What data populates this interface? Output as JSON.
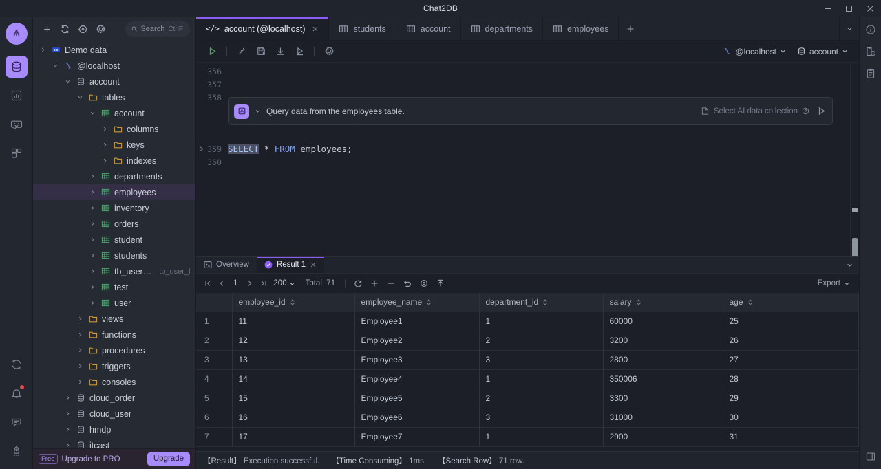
{
  "window": {
    "title": "Chat2DB",
    "controls": {
      "minimize": "minimize-icon",
      "maximize": "maximize-icon",
      "close": "close-icon"
    }
  },
  "rail": {
    "items": [
      {
        "icon": "chat2db-logo-icon",
        "name": "app-logo",
        "active": false
      },
      {
        "icon": "database-icon",
        "name": "rail-item-database",
        "active": true
      },
      {
        "icon": "chart-bar-icon",
        "name": "rail-item-dashboard",
        "active": false
      },
      {
        "icon": "chat-smile-icon",
        "name": "rail-item-ai-chat",
        "active": false
      },
      {
        "icon": "apps-grid-icon",
        "name": "rail-item-extensions",
        "active": false
      }
    ],
    "bottom_items": [
      {
        "icon": "refresh-icon",
        "name": "rail-item-refresh",
        "badge": false
      },
      {
        "icon": "bell-icon",
        "name": "rail-item-notifications",
        "badge": true
      },
      {
        "icon": "feedback-icon",
        "name": "rail-item-feedback",
        "badge": false
      },
      {
        "icon": "rocket-icon",
        "name": "rail-item-upgrade",
        "badge": false
      }
    ]
  },
  "sidebar": {
    "toolbar": [
      {
        "icon": "plus-icon",
        "name": "add-connection-button"
      },
      {
        "icon": "refresh-icon",
        "name": "refresh-tree-button"
      },
      {
        "icon": "target-icon",
        "name": "locate-button"
      },
      {
        "icon": "gear-icon",
        "name": "settings-button"
      }
    ],
    "search": {
      "placeholder": "Search",
      "shortcut": "CtrlF"
    },
    "tree": [
      {
        "label": "Demo data",
        "depth": 0,
        "icon": "demo-data-icon",
        "caret": "closed",
        "selected": false
      },
      {
        "label": "@localhost",
        "depth": 1,
        "icon": "connection-icon",
        "caret": "open",
        "selected": false
      },
      {
        "label": "account",
        "depth": 2,
        "icon": "database-icon",
        "caret": "open",
        "selected": false
      },
      {
        "label": "tables",
        "depth": 3,
        "icon": "folder-icon",
        "caret": "open",
        "selected": false
      },
      {
        "label": "account",
        "depth": 4,
        "icon": "table-icon",
        "caret": "open",
        "selected": false
      },
      {
        "label": "columns",
        "depth": 5,
        "icon": "folder-icon",
        "caret": "closed",
        "selected": false
      },
      {
        "label": "keys",
        "depth": 5,
        "icon": "folder-icon",
        "caret": "closed",
        "selected": false
      },
      {
        "label": "indexes",
        "depth": 5,
        "icon": "folder-icon",
        "caret": "closed",
        "selected": false
      },
      {
        "label": "departments",
        "depth": 4,
        "icon": "table-icon",
        "caret": "closed",
        "selected": false
      },
      {
        "label": "employees",
        "depth": 4,
        "icon": "table-icon",
        "caret": "closed",
        "selected": true
      },
      {
        "label": "inventory",
        "depth": 4,
        "icon": "table-icon",
        "caret": "closed",
        "selected": false
      },
      {
        "label": "orders",
        "depth": 4,
        "icon": "table-icon",
        "caret": "closed",
        "selected": false
      },
      {
        "label": "student",
        "depth": 4,
        "icon": "table-icon",
        "caret": "closed",
        "selected": false
      },
      {
        "label": "students",
        "depth": 4,
        "icon": "table-icon",
        "caret": "closed",
        "selected": false
      },
      {
        "label": "tb_user_local",
        "sublabel": "tb_user_loca",
        "depth": 4,
        "icon": "table-icon",
        "caret": "closed",
        "selected": false
      },
      {
        "label": "test",
        "depth": 4,
        "icon": "table-icon",
        "caret": "closed",
        "selected": false
      },
      {
        "label": "user",
        "depth": 4,
        "icon": "table-icon",
        "caret": "closed",
        "selected": false
      },
      {
        "label": "views",
        "depth": 3,
        "icon": "folder-icon",
        "caret": "closed",
        "selected": false
      },
      {
        "label": "functions",
        "depth": 3,
        "icon": "folder-icon",
        "caret": "closed",
        "selected": false
      },
      {
        "label": "procedures",
        "depth": 3,
        "icon": "folder-icon",
        "caret": "closed",
        "selected": false
      },
      {
        "label": "triggers",
        "depth": 3,
        "icon": "folder-icon",
        "caret": "closed",
        "selected": false
      },
      {
        "label": "consoles",
        "depth": 3,
        "icon": "folder-icon",
        "caret": "closed",
        "selected": false
      },
      {
        "label": "cloud_order",
        "depth": 2,
        "icon": "database-icon",
        "caret": "closed",
        "selected": false
      },
      {
        "label": "cloud_user",
        "depth": 2,
        "icon": "database-icon",
        "caret": "closed",
        "selected": false
      },
      {
        "label": "hmdp",
        "depth": 2,
        "icon": "database-icon",
        "caret": "closed",
        "selected": false
      },
      {
        "label": "itcast",
        "depth": 2,
        "icon": "database-icon",
        "caret": "closed",
        "selected": false
      }
    ],
    "upgrade": {
      "badge": "Free",
      "text": "Upgrade to PRO",
      "button": "Upgrade"
    }
  },
  "tabs": [
    {
      "label": "account (@localhost)",
      "icon": "code-icon",
      "active": true,
      "closable": true
    },
    {
      "label": "students",
      "icon": "table-icon",
      "active": false,
      "closable": false
    },
    {
      "label": "account",
      "icon": "table-icon",
      "active": false,
      "closable": false
    },
    {
      "label": "departments",
      "icon": "table-icon",
      "active": false,
      "closable": false
    },
    {
      "label": "employees",
      "icon": "table-icon",
      "active": false,
      "closable": false
    }
  ],
  "editor_toolbar": {
    "buttons": [
      {
        "icon": "play-icon",
        "name": "execute-button"
      },
      {
        "icon": "magic-wand-icon",
        "name": "format-sql-button"
      },
      {
        "icon": "save-icon",
        "name": "save-button"
      },
      {
        "icon": "download-icon",
        "name": "download-button"
      },
      {
        "icon": "play-outline-icon",
        "name": "execute-to-file-button"
      },
      {
        "icon": "gear-icon",
        "name": "editor-settings-button"
      }
    ],
    "connection": "@localhost",
    "database": "account"
  },
  "editor": {
    "lines": [
      {
        "number": "356",
        "text": "",
        "current": false
      },
      {
        "number": "357",
        "text": "",
        "current": false
      },
      {
        "number": "358",
        "text": "",
        "current": false
      },
      {
        "number": "359",
        "text": "SELECT * FROM employees;",
        "current": true
      },
      {
        "number": "360",
        "text": "",
        "current": false
      }
    ],
    "sql_tokens": {
      "keyword1": "SELECT",
      "star": "*",
      "keyword2": "FROM",
      "table": "employees;"
    },
    "ai_bar": {
      "prompt": "Query data from the employees table.",
      "collection_label": "Select AI data collection",
      "send_icon": "send-icon"
    }
  },
  "result_panel": {
    "tabs": [
      {
        "label": "Overview",
        "icon": "terminal-icon",
        "active": false,
        "closable": false
      },
      {
        "label": "Result 1",
        "icon": "success-check-icon",
        "active": true,
        "closable": true
      }
    ],
    "pagination": {
      "page": "1",
      "page_size": "200",
      "total_label": "Total:",
      "total": "71"
    },
    "toolbar_icons": [
      {
        "icon": "refresh-icon",
        "name": "refresh-result-button"
      },
      {
        "icon": "plus-icon",
        "name": "add-row-button"
      },
      {
        "icon": "minus-icon",
        "name": "delete-row-button"
      },
      {
        "icon": "undo-icon",
        "name": "revert-button"
      },
      {
        "icon": "eye-icon",
        "name": "preview-button"
      },
      {
        "icon": "upload-icon",
        "name": "commit-button"
      }
    ],
    "export_label": "Export",
    "columns": [
      "employee_id",
      "employee_name",
      "department_id",
      "salary",
      "age"
    ],
    "rows": [
      {
        "n": "1",
        "employee_id": "11",
        "employee_name": "Employee1",
        "department_id": "1",
        "salary": "60000",
        "age": "25"
      },
      {
        "n": "2",
        "employee_id": "12",
        "employee_name": "Employee2",
        "department_id": "2",
        "salary": "3200",
        "age": "26"
      },
      {
        "n": "3",
        "employee_id": "13",
        "employee_name": "Employee3",
        "department_id": "3",
        "salary": "2800",
        "age": "27"
      },
      {
        "n": "4",
        "employee_id": "14",
        "employee_name": "Employee4",
        "department_id": "1",
        "salary": "350006",
        "age": "28"
      },
      {
        "n": "5",
        "employee_id": "15",
        "employee_name": "Employee5",
        "department_id": "2",
        "salary": "3300",
        "age": "29"
      },
      {
        "n": "6",
        "employee_id": "16",
        "employee_name": "Employee6",
        "department_id": "3",
        "salary": "31000",
        "age": "30"
      },
      {
        "n": "7",
        "employee_id": "17",
        "employee_name": "Employee7",
        "department_id": "1",
        "salary": "2900",
        "age": "31"
      }
    ]
  },
  "statusbar": {
    "result_label": "【Result】",
    "result_value": "Execution successful.",
    "time_label": "【Time Consuming】",
    "time_value": "1ms.",
    "rows_label": "【Search Row】",
    "rows_value": "71 row."
  },
  "right_rail": [
    {
      "icon": "info-circle-icon",
      "name": "info-button"
    },
    {
      "icon": "history-clipboard-icon",
      "name": "execution-history-button"
    },
    {
      "icon": "clipboard-list-icon",
      "name": "saved-queries-button"
    }
  ],
  "colors": {
    "accent": "#8b5cf6",
    "accent_light": "#a78bfa",
    "success": "#4ba36a",
    "error": "#d13438",
    "bg": "#1c1f27",
    "panel": "#262a33",
    "keyword": "#7aa2f7"
  }
}
